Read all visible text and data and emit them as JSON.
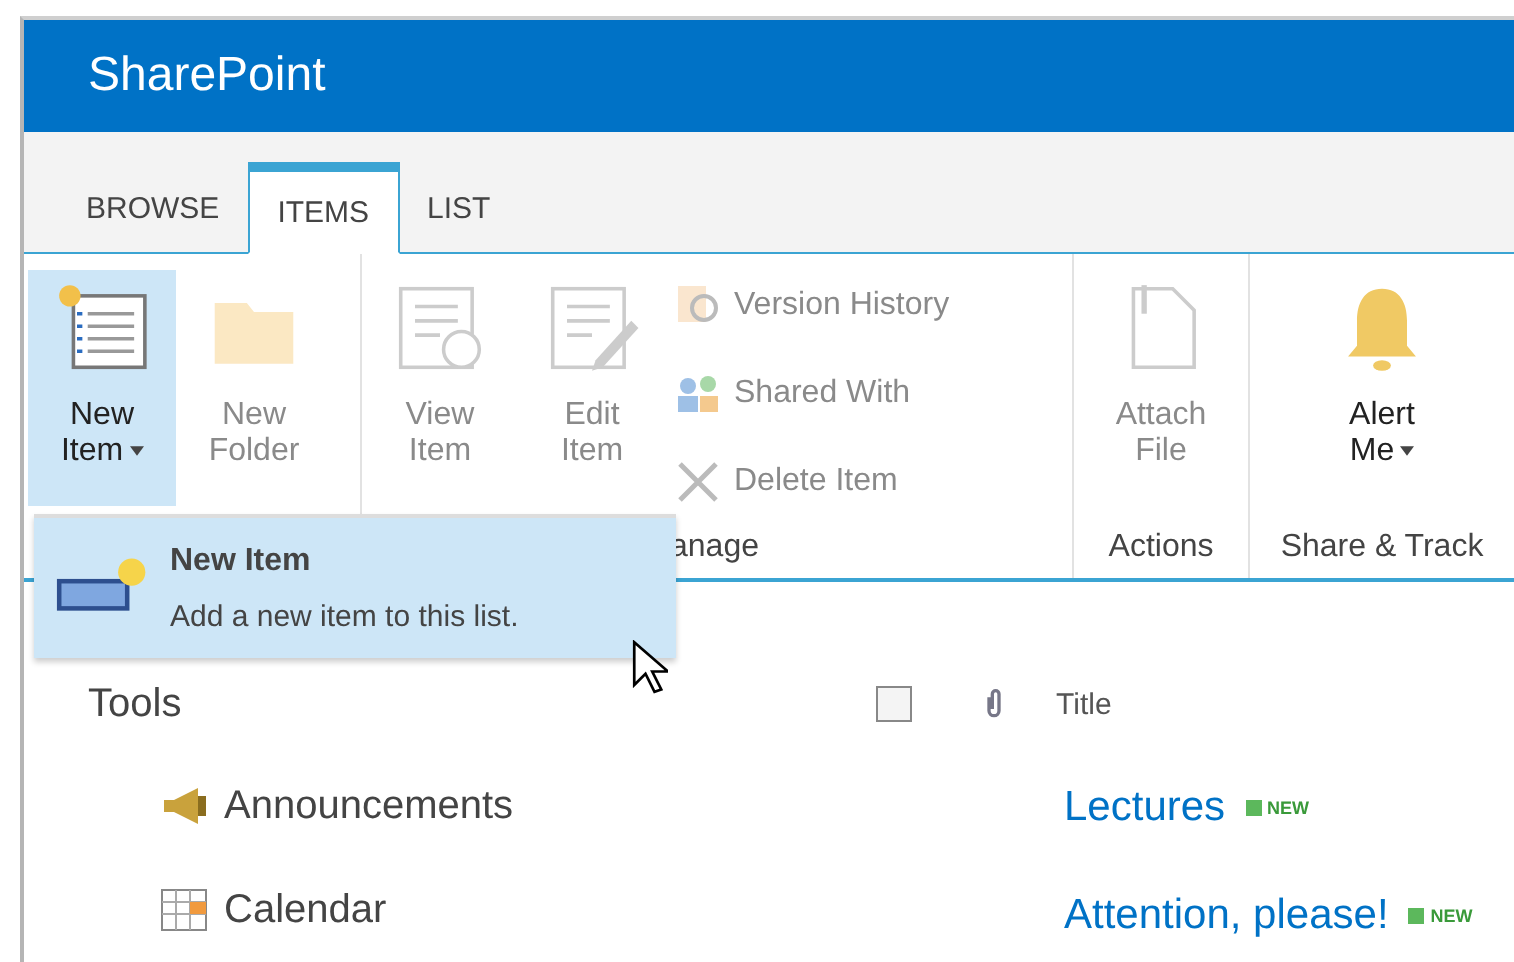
{
  "header": {
    "title": "SharePoint"
  },
  "tabs": [
    {
      "label": "BROWSE",
      "selected": false
    },
    {
      "label": "ITEMS",
      "selected": true
    },
    {
      "label": "LIST",
      "selected": false
    }
  ],
  "ribbon_groups": [
    {
      "buttons": [
        {
          "kind": "large",
          "label": "New\nItem",
          "disabled": false,
          "expanded": true,
          "has_menu": true
        },
        {
          "kind": "large",
          "label": "New\nFolder",
          "disabled": true,
          "expanded": false,
          "has_menu": false
        }
      ]
    },
    {
      "label": "anage",
      "buttons": [
        {
          "kind": "large",
          "label": "View\nItem",
          "disabled": true,
          "expanded": false,
          "has_menu": false
        },
        {
          "kind": "large",
          "label": "Edit\nItem",
          "disabled": true,
          "expanded": false,
          "has_menu": false
        },
        {
          "kind": "small",
          "label": "Version History",
          "disabled": true
        },
        {
          "kind": "small",
          "label": "Shared With",
          "disabled": true
        },
        {
          "kind": "small",
          "label": "Delete Item",
          "disabled": true
        }
      ]
    },
    {
      "label": "Actions",
      "buttons": [
        {
          "kind": "large",
          "label": "Attach\nFile",
          "disabled": true,
          "expanded": false,
          "has_menu": false
        }
      ]
    },
    {
      "label": "Share & Track",
      "buttons": [
        {
          "kind": "large",
          "label": "Alert\nMe",
          "disabled": false,
          "expanded": false,
          "has_menu": true
        }
      ]
    }
  ],
  "dropdown": {
    "title": "New Item",
    "description": "Add a new item to this list."
  },
  "nav": {
    "heading": "Tools",
    "items": [
      {
        "label": "Announcements"
      },
      {
        "label": "Calendar"
      }
    ]
  },
  "list": {
    "select_all": {
      "checked": false
    },
    "columns": [
      "Title"
    ],
    "rows": [
      {
        "title": "Lectures",
        "badge": "NEW"
      },
      {
        "title": "Attention, please!",
        "badge": "NEW"
      }
    ]
  }
}
